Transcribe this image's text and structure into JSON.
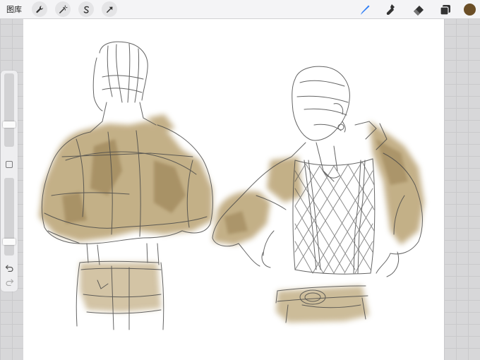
{
  "toolbar": {
    "gallery_label": "图库",
    "left_tools": [
      "wrench-icon",
      "magic-wand-icon",
      "selection-s-icon",
      "transform-arrow-icon"
    ],
    "right_tools": [
      "brush-icon",
      "smudge-icon",
      "eraser-icon",
      "layers-icon"
    ],
    "active_tool": "brush-icon",
    "accent_color": "#2f7ef5",
    "current_color": "#6b4e26"
  },
  "sidebar": {
    "brush_size_level": 0.28,
    "opacity_level": 0.15,
    "undo_icon": "undo-icon",
    "redo_icon": "redo-icon",
    "modify_button": "square-icon"
  },
  "canvas": {
    "background": "#ffffff",
    "ink_color": "#4a4a4a",
    "wash_color": "#b39a66"
  }
}
